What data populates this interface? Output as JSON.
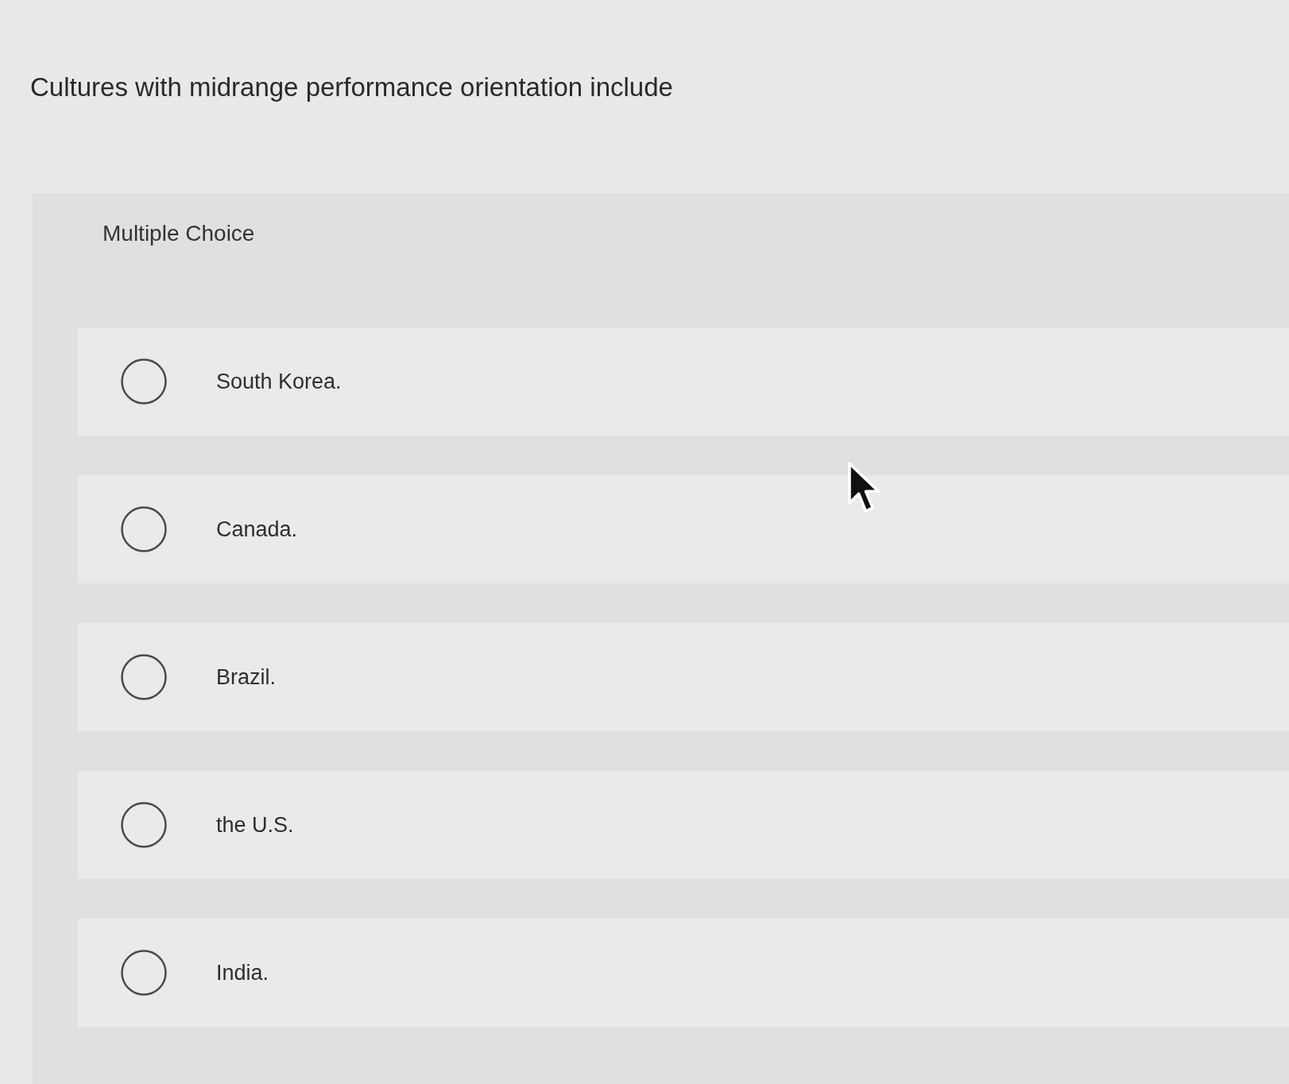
{
  "question": "Cultures with midrange performance orientation include",
  "panel": {
    "label": "Multiple Choice",
    "options": [
      {
        "label": "South Korea.",
        "selected": false
      },
      {
        "label": "Canada.",
        "selected": false
      },
      {
        "label": "Brazil.",
        "selected": false
      },
      {
        "label": "the U.S.",
        "selected": false
      },
      {
        "label": "India.",
        "selected": false
      }
    ]
  }
}
